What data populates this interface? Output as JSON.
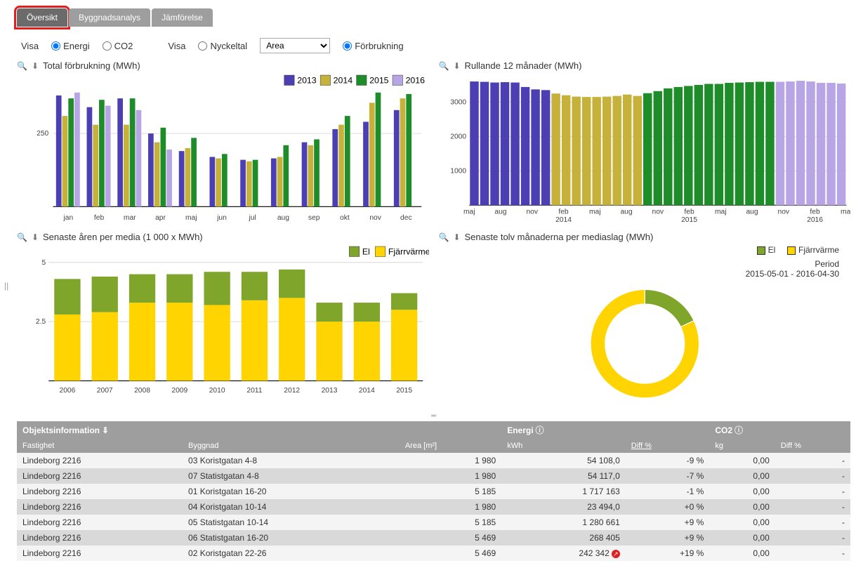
{
  "tabs": {
    "overview": "Översikt",
    "building": "Byggnadsanalys",
    "compare": "Jämförelse"
  },
  "filters": {
    "show1_label": "Visa",
    "opt_energy": "Energi",
    "opt_co2": "CO2",
    "show2_label": "Visa",
    "opt_key": "Nyckeltal",
    "select_value": "Area",
    "opt_consumption": "Förbrukning"
  },
  "colors": {
    "y2013": "#4b3fb3",
    "y2014": "#c6b23a",
    "y2015": "#1e8c28",
    "y2016": "#b8a5e6",
    "el": "#7fa52a",
    "fjarr": "#ffd400"
  },
  "chart_data": [
    {
      "id": "c1",
      "title": "Total förbrukning (MWh)",
      "type": "bar",
      "categories": [
        "jan",
        "feb",
        "mar",
        "apr",
        "maj",
        "jun",
        "jul",
        "aug",
        "sep",
        "okt",
        "nov",
        "dec"
      ],
      "series": [
        {
          "name": "2013",
          "values": [
            380,
            340,
            370,
            250,
            190,
            170,
            160,
            165,
            220,
            265,
            290,
            330
          ]
        },
        {
          "name": "2014",
          "values": [
            310,
            280,
            280,
            220,
            200,
            165,
            155,
            170,
            210,
            280,
            355,
            370
          ]
        },
        {
          "name": "2015",
          "values": [
            370,
            365,
            370,
            270,
            235,
            180,
            160,
            210,
            230,
            310,
            390,
            385
          ]
        },
        {
          "name": "2016",
          "values": [
            390,
            345,
            330,
            195,
            null,
            null,
            null,
            null,
            null,
            null,
            null,
            null
          ]
        }
      ],
      "ylim": [
        0,
        400
      ],
      "ytick": 250
    },
    {
      "id": "c2",
      "title": "Rullande 12 månader (MWh)",
      "type": "bar",
      "x": [
        "maj",
        "",
        "aug",
        "",
        "nov",
        "",
        "feb 2014",
        "",
        "maj",
        "",
        "aug",
        "",
        "nov",
        "",
        "feb 2015",
        "",
        "maj",
        "",
        "aug",
        "",
        "nov",
        "",
        "feb 2016",
        "",
        "maj"
      ],
      "values": [
        3600,
        3590,
        3570,
        3580,
        3570,
        3440,
        3370,
        3350,
        3250,
        3200,
        3160,
        3150,
        3150,
        3160,
        3180,
        3220,
        3180,
        3260,
        3320,
        3400,
        3440,
        3470,
        3500,
        3530,
        3530,
        3560,
        3570,
        3580,
        3590,
        3590,
        3590,
        3600,
        3620,
        3600,
        3560,
        3560,
        3540
      ],
      "color_segments": [
        {
          "start": 0,
          "end": 8,
          "color": "y2013"
        },
        {
          "start": 8,
          "end": 17,
          "color": "y2014"
        },
        {
          "start": 17,
          "end": 30,
          "color": "y2015"
        },
        {
          "start": 30,
          "end": 37,
          "color": "y2016"
        }
      ],
      "ylim": [
        0,
        3700
      ],
      "yticks": [
        1000,
        2000,
        3000
      ]
    },
    {
      "id": "c3",
      "title": "Senaste åren per media (1 000 x MWh)",
      "type": "bar_stacked",
      "categories": [
        "2006",
        "2007",
        "2008",
        "2009",
        "2010",
        "2011",
        "2012",
        "2013",
        "2014",
        "2015"
      ],
      "series": [
        {
          "name": "Fjärrvärme",
          "values": [
            2.8,
            2.9,
            3.3,
            3.3,
            3.2,
            3.4,
            3.5,
            2.5,
            2.5,
            3.0
          ]
        },
        {
          "name": "El",
          "values": [
            1.5,
            1.5,
            1.2,
            1.2,
            1.4,
            1.2,
            1.2,
            0.8,
            0.8,
            0.7
          ]
        }
      ],
      "legend": {
        "el": "El",
        "fjarr": "Fjärrvärme"
      },
      "ylim": [
        0,
        5
      ],
      "yticks": [
        2.5,
        5
      ]
    },
    {
      "id": "c4",
      "title": "Senaste tolv månaderna per mediaslag (MWh)",
      "type": "donut",
      "slices": [
        {
          "name": "El",
          "value": 18,
          "color": "el"
        },
        {
          "name": "Fjärrvärme",
          "value": 82,
          "color": "fjarr"
        }
      ],
      "legend": {
        "el": "El",
        "fjarr": "Fjärrvärme"
      },
      "period_label": "Period",
      "period_value": "2015-05-01 - 2016-04-30"
    }
  ],
  "table": {
    "header": {
      "obj": "Objektsinformation",
      "energy": "Energi",
      "co2": "CO2",
      "fastighet": "Fastighet",
      "byggnad": "Byggnad",
      "area": "Area [m²]",
      "kwh": "kWh",
      "diff": "Diff %",
      "kg": "kg",
      "diff2": "Diff %"
    },
    "rows": [
      {
        "f": "Lindeborg 2216",
        "b": "03 Koristgatan 4-8",
        "area": "1 980",
        "kwh": "54 108,0",
        "d": "-9 %",
        "kg": "0,00",
        "d2": "-"
      },
      {
        "f": "Lindeborg 2216",
        "b": "07 Statistgatan 4-8",
        "area": "1 980",
        "kwh": "54 117,0",
        "d": "-7 %",
        "kg": "0,00",
        "d2": "-"
      },
      {
        "f": "Lindeborg 2216",
        "b": "01 Koristgatan 16-20",
        "area": "5 185",
        "kwh": "1 717 163",
        "d": "-1 %",
        "kg": "0,00",
        "d2": "-"
      },
      {
        "f": "Lindeborg 2216",
        "b": "04 Koristgatan 10-14",
        "area": "1 980",
        "kwh": "23 494,0",
        "d": "+0 %",
        "kg": "0,00",
        "d2": "-"
      },
      {
        "f": "Lindeborg 2216",
        "b": "05 Statistgatan 10-14",
        "area": "5 185",
        "kwh": "1 280 661",
        "d": "+9 %",
        "kg": "0,00",
        "d2": "-"
      },
      {
        "f": "Lindeborg 2216",
        "b": "06 Statistgatan 16-20",
        "area": "5 469",
        "kwh": "268 405",
        "d": "+9 %",
        "kg": "0,00",
        "d2": "-"
      },
      {
        "f": "Lindeborg 2216",
        "b": "02 Koristgatan 22-26",
        "area": "5 469",
        "kwh": "242 342",
        "d": "+19 %",
        "kg": "0,00",
        "d2": "-",
        "alert": true
      }
    ]
  }
}
